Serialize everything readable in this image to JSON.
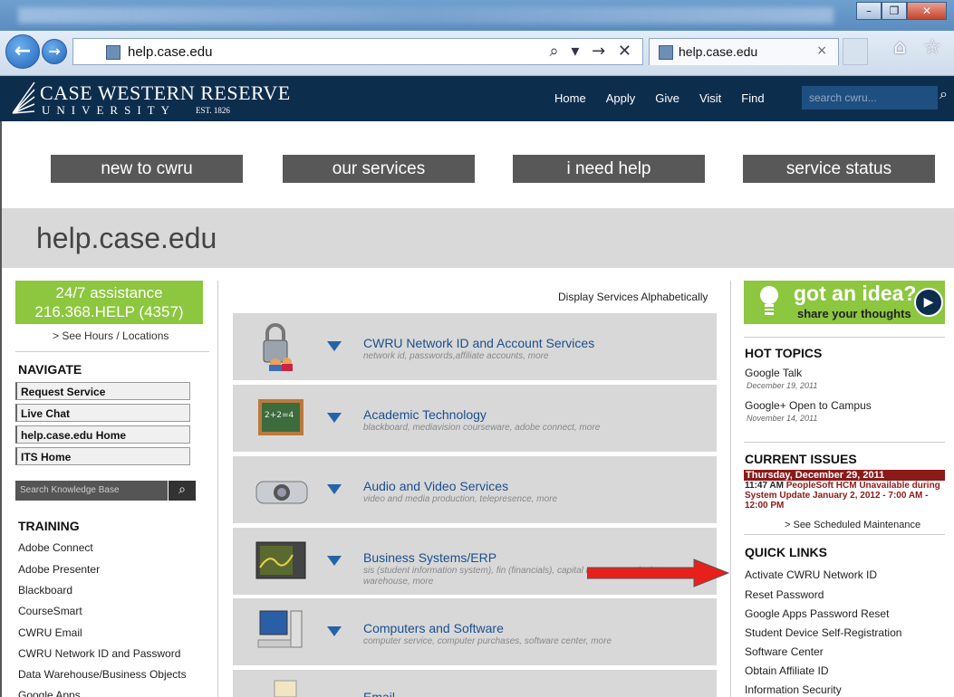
{
  "browser": {
    "address": "help.case.edu",
    "tab_title": "help.case.edu",
    "tab_close": "×",
    "address_tools": "⌕ ▾ → ✕",
    "back_icon": "←",
    "forward_icon": "→",
    "right_icons": "⌂ ☆",
    "window_buttons": [
      "–",
      "❐",
      "✕"
    ]
  },
  "site": {
    "logo_main": "CASE WESTERN RESERVE",
    "logo_sub": "UNIVERSITY",
    "logo_est": "EST. 1826",
    "topnav": [
      "Home",
      "Apply",
      "Give",
      "Visit",
      "Find"
    ],
    "search_placeholder": "search cwru...",
    "search_icon": "⌕"
  },
  "mainnav": [
    "new to cwru",
    "our services",
    "i need help",
    "service status"
  ],
  "page_title": "help.case.edu",
  "left": {
    "assist_line1": "24/7 assistance",
    "assist_line2": "216.368.HELP (4357)",
    "hours_link": "> See Hours / Locations",
    "navigate_heading": "NAVIGATE",
    "nav_buttons": [
      "Request Service",
      "Live Chat",
      "help.case.edu Home",
      "ITS Home"
    ],
    "kb_search_placeholder": "Search Knowledge Base",
    "kb_search_icon": "⌕",
    "training_heading": "TRAINING",
    "training_links": [
      "Adobe Connect",
      "Adobe Presenter",
      "Blackboard",
      "CourseSmart",
      "CWRU Email",
      "CWRU Network ID and Password",
      "Data Warehouse/Business Objects",
      "Google Apps"
    ]
  },
  "center": {
    "alpha_link": "Display Services Alphabetically",
    "services": [
      {
        "title": "CWRU Network ID and Account Services",
        "desc": "network id, passwords,affiliate accounts, more",
        "icon": "lock-users-icon"
      },
      {
        "title": "Academic Technology",
        "desc": "blackboard, mediavision courseware, adobe connect, more",
        "icon": "chalkboard-icon"
      },
      {
        "title": "Audio and Video Services",
        "desc": "video and media production, telepresence, more",
        "icon": "projector-icon"
      },
      {
        "title": "Business Systems/ERP",
        "desc": "sis (student information system), fin (financials), capital management), data warehouse, more",
        "icon": "monitor-chart-icon"
      },
      {
        "title": "Computers and Software",
        "desc": "computer service, computer purchases, software center, more",
        "icon": "computer-icon"
      },
      {
        "title": "Email",
        "desc": "",
        "icon": "email-icon"
      }
    ]
  },
  "right": {
    "idea_title": "got an idea?",
    "idea_sub": "share your thoughts",
    "hot_topics_heading": "HOT TOPICS",
    "hot_topics": [
      {
        "title": "Google Talk",
        "date": "December 19, 2011"
      },
      {
        "title": "Google+ Open to Campus",
        "date": "November 14, 2011"
      }
    ],
    "current_issues_heading": "CURRENT ISSUES",
    "issue_date": "Thursday, December 29, 2011",
    "issue_time": "11:47 AM",
    "issue_text": "PeopleSoft HCM Unavailable during System Update January 2, 2012 - 7:00 AM - 12:00 PM",
    "sched_link": "> See Scheduled Maintenance",
    "quick_links_heading": "QUICK LINKS",
    "quick_links": [
      "Activate CWRU Network ID",
      "Reset Password",
      "Google Apps Password Reset",
      "Student Device Self-Registration",
      "Software Center",
      "Obtain Affiliate ID",
      "Information Security"
    ]
  },
  "colors": {
    "brand_navy": "#0d2d4d",
    "accent_green": "#8dc63f",
    "nav_gray": "#585858",
    "issue_red": "#8b1a1a",
    "annotation_arrow": "#e8201c"
  }
}
